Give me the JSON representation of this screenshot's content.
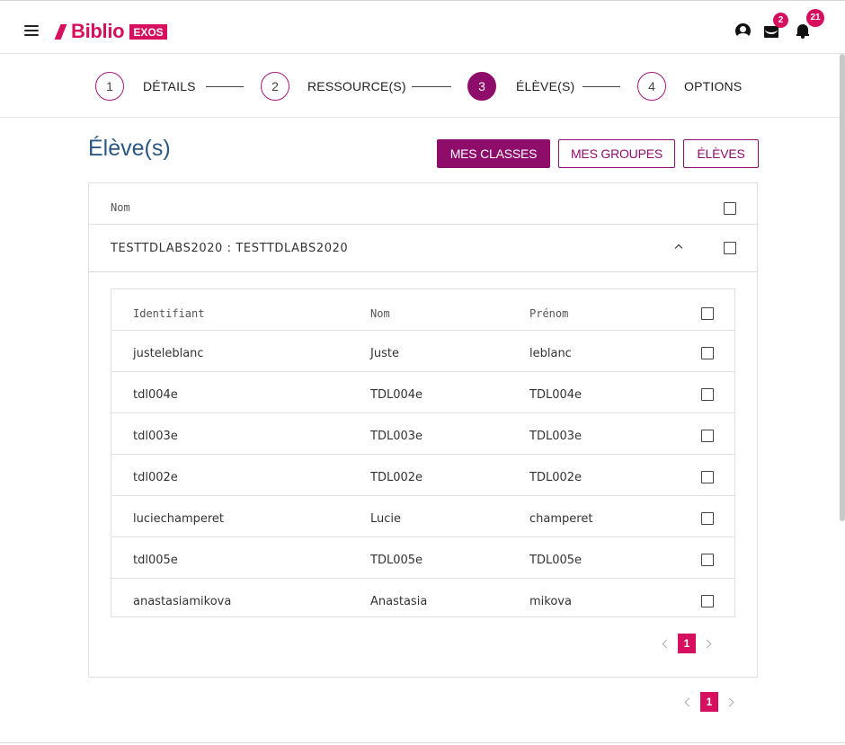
{
  "header": {
    "logo_text": "Biblio",
    "logo_badge": "EXOS",
    "mail_badge": "2",
    "notification_badge": "21"
  },
  "stepper": {
    "steps": [
      {
        "number": "1",
        "label": "DÉTAILS",
        "active": false
      },
      {
        "number": "2",
        "label": "RESSOURCE(S)",
        "active": false
      },
      {
        "number": "3",
        "label": "ÉLÈVE(S)",
        "active": true
      },
      {
        "number": "4",
        "label": "OPTIONS",
        "active": false
      }
    ]
  },
  "page": {
    "title": "Élève(s)",
    "buttons": {
      "mes_classes": "MES CLASSES",
      "mes_groupes": "MES GROUPES",
      "eleves": "ÉLÈVES"
    }
  },
  "panel": {
    "header_label": "Nom",
    "group_label": "TESTTDLABS2020 : TESTTDLABS2020",
    "table": {
      "columns": [
        "Identifiant",
        "Nom",
        "Prénom"
      ],
      "rows": [
        {
          "identifiant": "justeleblanc",
          "nom": "Juste",
          "prenom": "leblanc"
        },
        {
          "identifiant": "tdl004e",
          "nom": "TDL004e",
          "prenom": "TDL004e"
        },
        {
          "identifiant": "tdl003e",
          "nom": "TDL003e",
          "prenom": "TDL003e"
        },
        {
          "identifiant": "tdl002e",
          "nom": "TDL002e",
          "prenom": "TDL002e"
        },
        {
          "identifiant": "luciechamperet",
          "nom": "Lucie",
          "prenom": "champeret"
        },
        {
          "identifiant": "tdl005e",
          "nom": "TDL005e",
          "prenom": "TDL005e"
        },
        {
          "identifiant": "anastasiamikova",
          "nom": "Anastasia",
          "prenom": "mikova"
        }
      ]
    },
    "inner_page": "1"
  },
  "outer_page": "1",
  "colors": {
    "brand_pink": "#d6105e",
    "primary_purple": "#8e0d6b",
    "title_blue": "#2b5884"
  }
}
